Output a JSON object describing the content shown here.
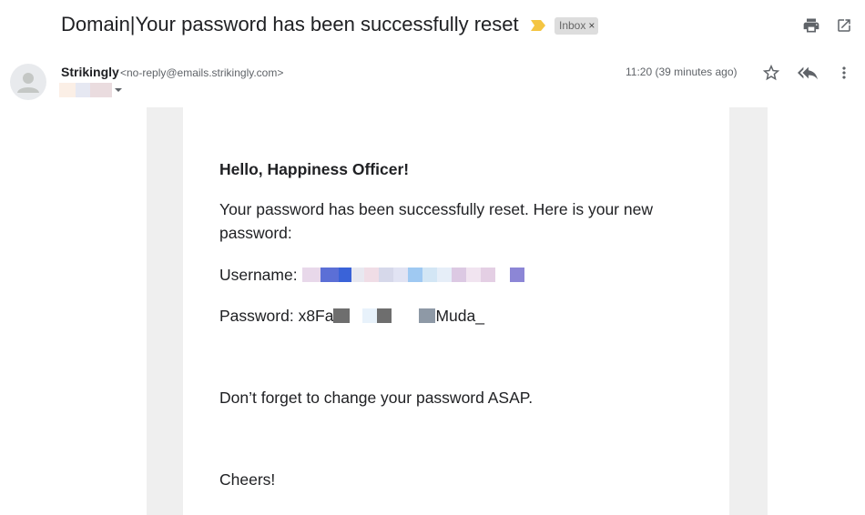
{
  "email": {
    "subject": "Domain|Your password has been successfully reset",
    "label_chip": "Inbox",
    "chip_close": "×",
    "sender_name": "Strikingly",
    "sender_email": "<no-reply@emails.strikingly.com>",
    "time": "11:20 (39 minutes ago)"
  },
  "body": {
    "greeting": "Hello, Happiness Officer!",
    "message": "Your password has been successfully reset. Here is your new password:",
    "username_label": "Username:",
    "password_label": "Password:",
    "password_prefix": "x8Fa",
    "password_suffix": "Muda_",
    "reminder": "Don’t forget to change your password ASAP.",
    "closing": "Cheers!"
  },
  "colors": {
    "importance_marker": "#f4c542",
    "chip_bg": "#dddddd",
    "frame_bg": "#efefef",
    "text": "#202124",
    "muted": "#5f6368"
  },
  "icons": [
    "importance-icon",
    "print-icon",
    "open-in-new-window-icon",
    "person-icon",
    "chevron-down-icon",
    "star-icon",
    "reply-all-icon",
    "more-vert-icon"
  ]
}
